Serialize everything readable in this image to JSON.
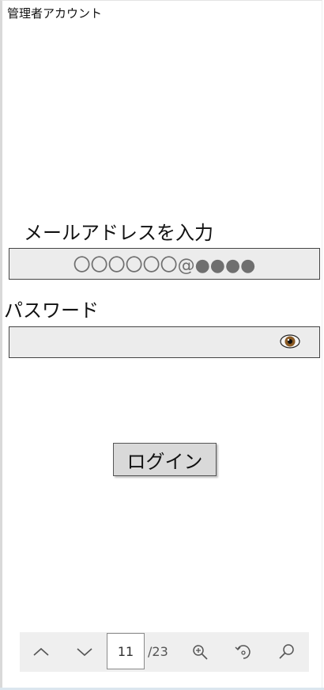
{
  "app": {
    "title": "管理者アカウント"
  },
  "form": {
    "email_label": "メールアドレスを入力",
    "email_placeholder": "〇〇〇〇〇〇@●●●●",
    "password_label": "パスワード",
    "password_value": "",
    "login_label": "ログイン"
  },
  "pager": {
    "current_page": "11",
    "total_pages": "/23",
    "icons": [
      "chevron-up-icon",
      "chevron-down-icon",
      "zoom-in-icon",
      "rotate-icon",
      "search-icon"
    ]
  },
  "colors": {
    "field_bg": "#ececec",
    "button_bg": "#d9d9d9",
    "toolbar_bg": "#efefef"
  }
}
